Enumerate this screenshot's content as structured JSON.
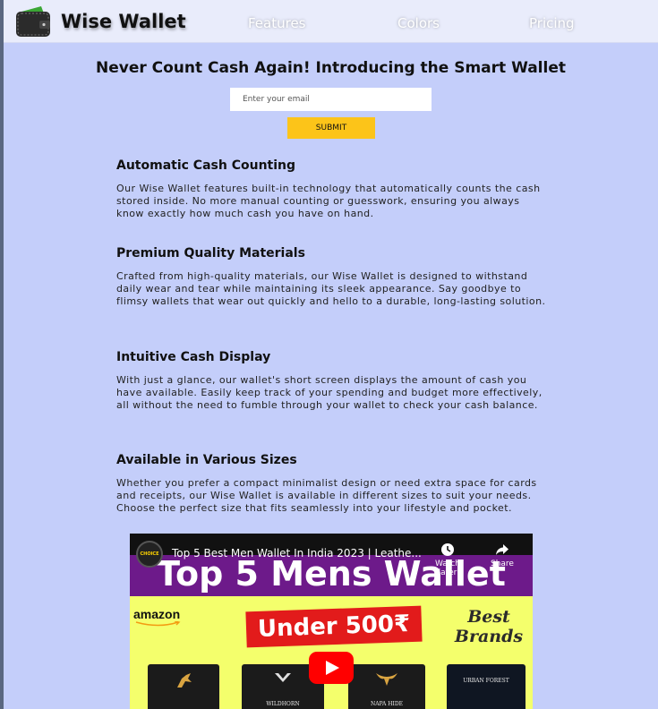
{
  "nav": {
    "brand": "Wise Wallet",
    "links": [
      "Features",
      "Colors",
      "Pricing"
    ]
  },
  "hero": {
    "title": "Never Count Cash Again! Introducing the Smart Wallet",
    "email_placeholder": "Enter your email",
    "submit_label": "SUBMIT"
  },
  "sections": [
    {
      "heading": "Automatic Cash Counting",
      "body": "Our Wise Wallet features built-in technology that automatically counts the cash stored inside. No more manual counting or guesswork, ensuring you always know exactly how much cash you have on hand."
    },
    {
      "heading": "Premium Quality Materials",
      "body": "Crafted from high-quality materials, our Wise Wallet is designed to withstand daily wear and tear while maintaining its sleek appearance. Say goodbye to flimsy wallets that wear out quickly and hello to a durable, long-lasting solution."
    },
    {
      "heading": "Intuitive Cash Display",
      "body": "With just a glance, our wallet's short screen displays the amount of cash you have available. Easily keep track of your spending and budget more effectively, all without the need to fumble through your wallet to check your cash balance."
    },
    {
      "heading": "Available in Various Sizes",
      "body": "Whether you prefer a compact minimalist design or need extra space for cards and receipts, our Wise Wallet is available in different sizes to suit your needs. Choose the perfect size that fits seamlessly into your lifestyle and pocket."
    }
  ],
  "video": {
    "title": "Top 5 Best Men Wallet In India 2023 | Leathe...",
    "channel": "CHOICE",
    "watch_later": "Watch later",
    "share": "Share",
    "banner": "Top 5 Mens Wallet",
    "amazon": "amazon",
    "under_badge": "Under 500₹",
    "best_brands": "Best Brands",
    "wallet_brands": [
      "",
      "WILDHORN",
      "NAPA HIDE",
      "URBAN FOREST"
    ]
  },
  "colors": {
    "page_bg": "#c4cefa",
    "nav_bg": "#e9ecfb",
    "submit_bg": "#fcc419",
    "play_button": "#ff0000"
  }
}
